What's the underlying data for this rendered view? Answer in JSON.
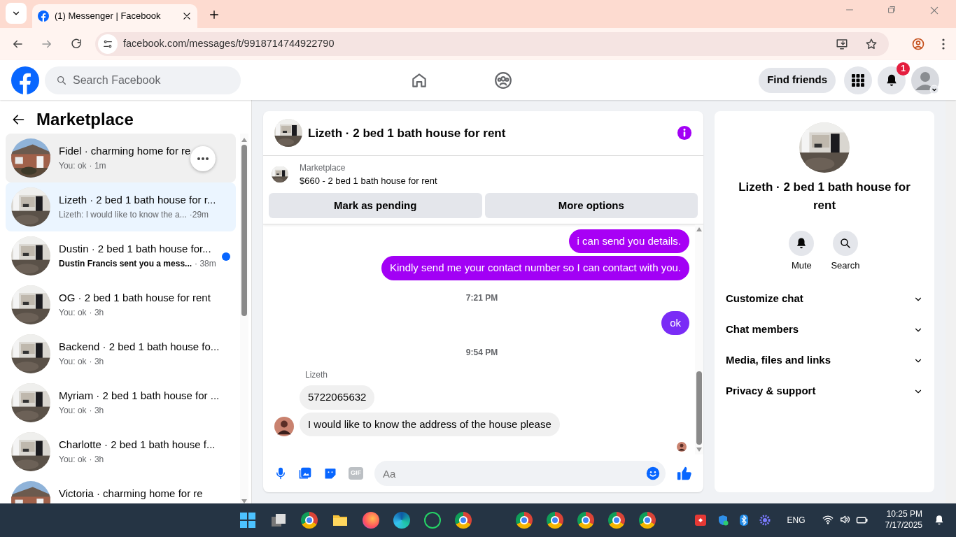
{
  "browser": {
    "tab_title": "(1) Messenger | Facebook",
    "url": "facebook.com/messages/t/9918714744922790"
  },
  "header": {
    "search_placeholder": "Search Facebook",
    "find_friends": "Find friends",
    "notification_count": "1"
  },
  "sidebar": {
    "title": "Marketplace",
    "conversations": [
      {
        "title": "Fidel · charming home for re",
        "preview": "You: ok",
        "time": "· 1m",
        "kind": "house",
        "selected": false,
        "hovered": true,
        "unread": false
      },
      {
        "title": "Lizeth · 2 bed 1 bath house for r...",
        "preview": "Lizeth: I would like to know the a...",
        "time": "·29m",
        "kind": "room",
        "selected": true,
        "hovered": false,
        "unread": false
      },
      {
        "title": "Dustin · 2 bed 1 bath house for...",
        "preview": "Dustin Francis sent you a mess...",
        "time": "· 38m",
        "kind": "room",
        "selected": false,
        "hovered": false,
        "unread": true
      },
      {
        "title": "OG · 2 bed 1 bath house for rent",
        "preview": "You: ok",
        "time": "· 3h",
        "kind": "room",
        "selected": false,
        "hovered": false,
        "unread": false
      },
      {
        "title": "Backend · 2 bed 1 bath house fo...",
        "preview": "You: ok",
        "time": "· 3h",
        "kind": "room",
        "selected": false,
        "hovered": false,
        "unread": false
      },
      {
        "title": "Myriam · 2 bed 1 bath house for ...",
        "preview": "You: ok",
        "time": "· 3h",
        "kind": "room",
        "selected": false,
        "hovered": false,
        "unread": false
      },
      {
        "title": "Charlotte · 2 bed 1 bath house f...",
        "preview": "You: ok",
        "time": "· 3h",
        "kind": "room",
        "selected": false,
        "hovered": false,
        "unread": false
      },
      {
        "title": "Victoria · charming home for re",
        "kind": "house",
        "selected": false,
        "hovered": false,
        "unread": false
      }
    ]
  },
  "chat": {
    "title": "Lizeth · 2 bed 1 bath house for rent",
    "listing": {
      "label": "Marketplace",
      "price_title": "$660 - 2 bed 1 bath house for rent",
      "buttons": [
        "Mark as pending",
        "More options"
      ]
    },
    "messages": [
      {
        "kind": "sent",
        "text": "i can send you details.",
        "color": "#a800f5"
      },
      {
        "kind": "sent",
        "text": "Kindly send me your contact number so I can contact with you.",
        "color": "#a200f5"
      },
      {
        "kind": "time",
        "text": "7:21 PM"
      },
      {
        "kind": "sent",
        "text": "ok",
        "color": "#7a2cf6"
      },
      {
        "kind": "time",
        "text": "9:54 PM"
      },
      {
        "kind": "received",
        "sender": "Lizeth",
        "texts": [
          "5722065632",
          "I would like to know the address of the house please"
        ]
      },
      {
        "kind": "seen"
      }
    ],
    "composer": {
      "placeholder": "Aa",
      "gif_label": "GIF"
    }
  },
  "details": {
    "title": "Lizeth · 2 bed 1 bath house for rent",
    "actions": [
      "Mute",
      "Search"
    ],
    "sections": [
      {
        "label": "Customize chat",
        "expanded": false
      },
      {
        "label": "Chat members",
        "expanded": false
      },
      {
        "label": "Media, files and links",
        "expanded": false
      },
      {
        "label": "Privacy & support",
        "expanded": false
      }
    ]
  },
  "taskbar": {
    "language": "ENG",
    "time": "10:25 PM",
    "date": "7/17/2025"
  }
}
